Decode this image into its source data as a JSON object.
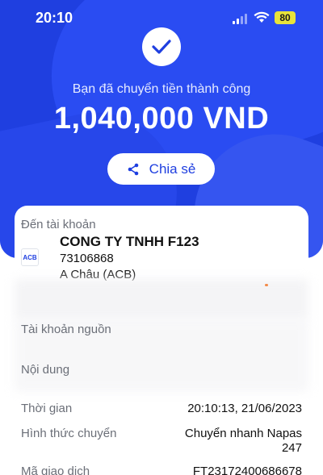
{
  "status_bar": {
    "time": "20:10",
    "battery": "80",
    "icons": [
      "signal-icon",
      "wifi-icon",
      "battery-icon"
    ]
  },
  "hero": {
    "success_message": "Bạn đã chuyển tiền thành công",
    "amount": "1,040,000 VND",
    "share_label": "Chia sẻ",
    "icons": [
      "checkmark-icon",
      "share-icon"
    ],
    "colors": {
      "primary": "#1f3fe0",
      "background": "#ffffff"
    }
  },
  "recipient": {
    "to_label": "Đến tài khoản",
    "bank_logo_text": "ACB",
    "name": "CONG TY TNHH F123",
    "account_number": "73106868",
    "bank": "A Châu (ACB)"
  },
  "details": [
    {
      "label": "Tài khoản nguồn",
      "value": ""
    },
    {
      "label": "Nội dung",
      "value": ""
    },
    {
      "label": "Thời gian",
      "value": "20:10:13, 21/06/2023"
    },
    {
      "label": "Hình thức chuyển",
      "value": "Chuyển nhanh Napas",
      "value_line2": "247"
    },
    {
      "label": "Mã giao dịch",
      "value": "FT23172400686678"
    }
  ]
}
